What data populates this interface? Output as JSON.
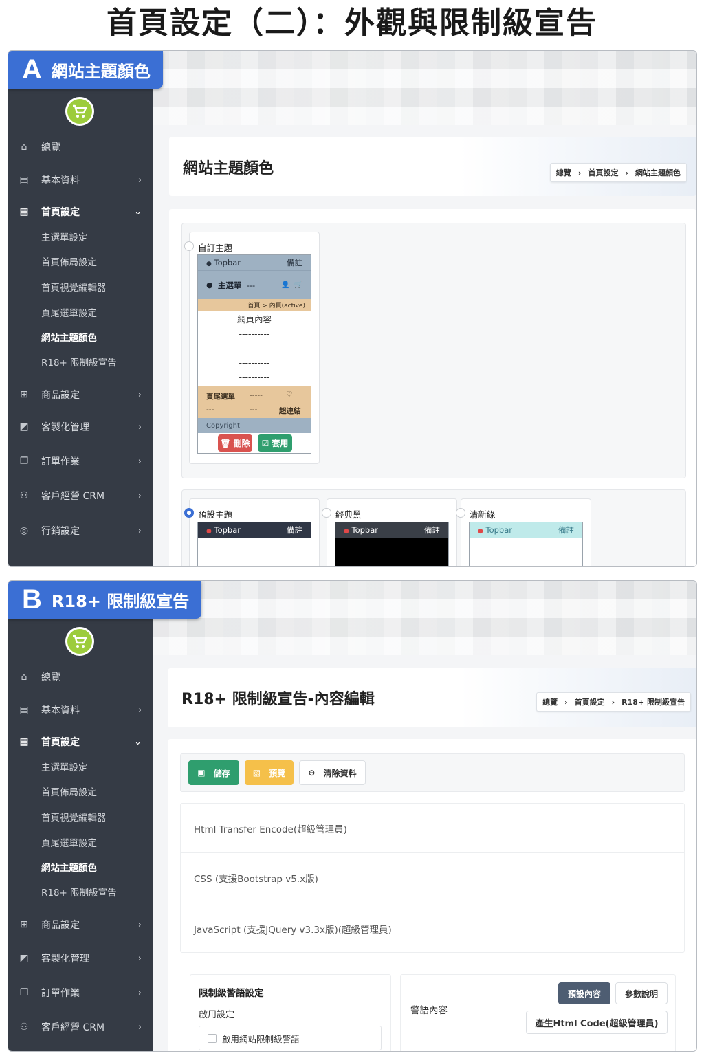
{
  "title": "首頁設定（二）：外觀與限制級宣告",
  "panels": {
    "a": {
      "letter": "A",
      "label": "網站主題顏色"
    },
    "b": {
      "letter": "B",
      "label": "R18+ 限制級宣告"
    }
  },
  "sidebar": {
    "items": [
      {
        "label": "總覽",
        "icon": "home-icon"
      },
      {
        "label": "基本資料",
        "icon": "list-icon"
      },
      {
        "label": "首頁設定",
        "icon": "store-icon"
      },
      {
        "label": "主選單設定"
      },
      {
        "label": "首頁佈局設定"
      },
      {
        "label": "首頁視覺編輯器"
      },
      {
        "label": "頁尾選單設定"
      },
      {
        "label": "網站主題顏色"
      },
      {
        "label": "R18+ 限制級宣告"
      },
      {
        "label": "商品設定",
        "icon": "gift-icon"
      },
      {
        "label": "客製化管理",
        "icon": "puzzle-icon"
      },
      {
        "label": "訂單作業",
        "icon": "clipboard-icon"
      },
      {
        "label": "客戶經營 CRM",
        "icon": "users-icon"
      },
      {
        "label": "行銷設定",
        "icon": "target-icon"
      }
    ]
  },
  "a": {
    "page_title": "網站主題顏色",
    "breadcrumb": [
      "總覽",
      "首頁設定",
      "網站主題顏色"
    ],
    "custom_theme": {
      "name": "自訂主題",
      "topbar": "Topbar",
      "note": "備註",
      "menu": "主選單",
      "menu_dash": "---",
      "nav_crumb": "首頁 > 內頁(active)",
      "content": "網頁內容",
      "dashes": [
        "----------",
        "----------",
        "----------",
        "----------"
      ],
      "footer_menu": "頁尾選單",
      "footer_dash": "-----",
      "footer_dash2": "---",
      "footer_dash3": "---",
      "footer_link": "超連結",
      "copyright": "Copyright",
      "delete_btn": "刪除",
      "apply_btn": "套用"
    },
    "presets": [
      {
        "name": "預設主題",
        "topbar": "Topbar",
        "note": "備註",
        "bar_color": "#2f3645",
        "body_color": "#ffffff",
        "text_color": "#ffffff",
        "selected": true
      },
      {
        "name": "經典黑",
        "topbar": "Topbar",
        "note": "備註",
        "bar_color": "#3a3f47",
        "body_color": "#000000",
        "text_color": "#ffffff",
        "selected": false
      },
      {
        "name": "清新綠",
        "topbar": "Topbar",
        "note": "備註",
        "bar_color": "#bfeaea",
        "body_color": "#ffffff",
        "text_color": "#3a7b8a",
        "selected": false
      }
    ]
  },
  "b": {
    "page_title": "R18+ 限制級宣告-內容編輯",
    "breadcrumb": [
      "總覽",
      "首頁設定",
      "R18+ 限制級宣告"
    ],
    "save_btn": "儲存",
    "preview_btn": "預覽",
    "clear_btn": "清除資料",
    "fields": [
      "Html Transfer Encode(超級管理員)",
      "CSS (支援Bootstrap v5.x版)",
      "JavaScript (支援JQuery v3.3x版)(超級管理員)"
    ],
    "warning_settings": {
      "title": "限制級警語設定",
      "enable_label": "啟用設定",
      "checkbox_label": "啟用網站限制級警語"
    },
    "warning_content": {
      "label": "警語內容",
      "default_btn": "預設內容",
      "param_btn": "參數說明",
      "gen_btn": "產生Html Code(超級管理員)"
    }
  }
}
